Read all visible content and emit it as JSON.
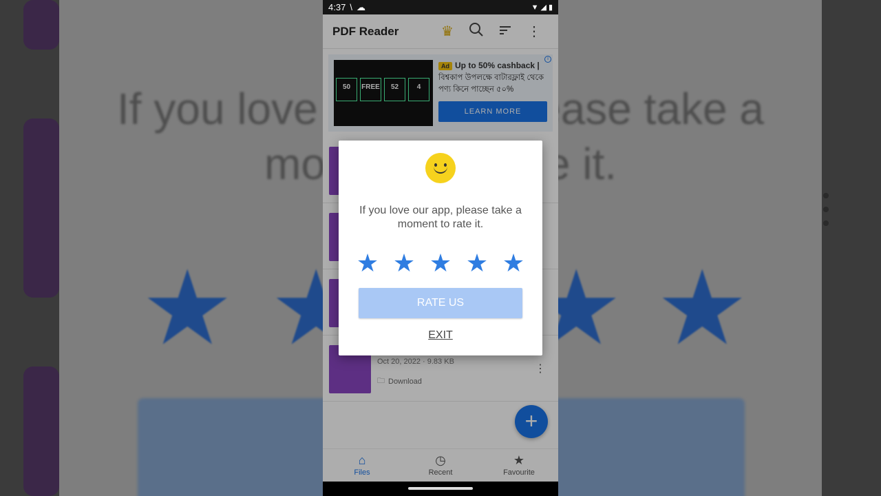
{
  "status": {
    "time": "4:37"
  },
  "app": {
    "title": "PDF Reader"
  },
  "ad": {
    "badge": "Ad",
    "headline": "Up to 50% cashback |",
    "body": "বিশ্বকাপ উপলক্ষে বাটারফ্লাই থেকে পণ্য কিনে পাচ্ছেন ৫০%",
    "cta": "LEARN MORE",
    "tile_free": "FREE",
    "tile_52": "52",
    "tile_50": "50",
    "tile_4": "4"
  },
  "files": [
    {
      "meta": "Oct 20, 2022 · 9.83 KB",
      "location": "Download"
    }
  ],
  "dialog": {
    "message": "If you love our app, please take a moment to rate it.",
    "rate_label": "RATE US",
    "exit_label": "EXIT",
    "stars": 5
  },
  "nav": {
    "files": "Files",
    "recent": "Recent",
    "favourite": "Favourite"
  },
  "backdrop": {
    "line1": "If you love",
    "line1b": "ease take a",
    "line2": "mo",
    "line2b": "e it."
  }
}
